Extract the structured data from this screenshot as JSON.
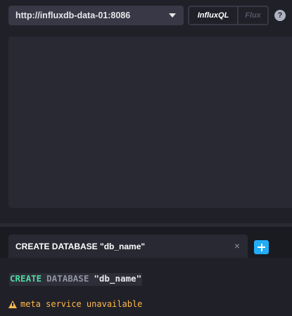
{
  "top_bar": {
    "source_url": "http://influxdb-data-01:8086",
    "languages": [
      {
        "label": "InfluxQL",
        "active": true
      },
      {
        "label": "Flux",
        "active": false
      }
    ],
    "help_label": "?"
  },
  "tabs": [
    {
      "label": "CREATE DATABASE \"db_name\""
    }
  ],
  "tab_close_label": "×",
  "editor": {
    "tokens": {
      "keyword_create": "CREATE",
      "keyword_database": "DATABASE",
      "string": "\"db_name\""
    },
    "error_message": "meta service unavailable"
  },
  "colors": {
    "background": "#202028",
    "panel": "#292933",
    "accent": "#22adf6",
    "keyword": "#4ed8a0",
    "warning": "#ffb94a"
  }
}
